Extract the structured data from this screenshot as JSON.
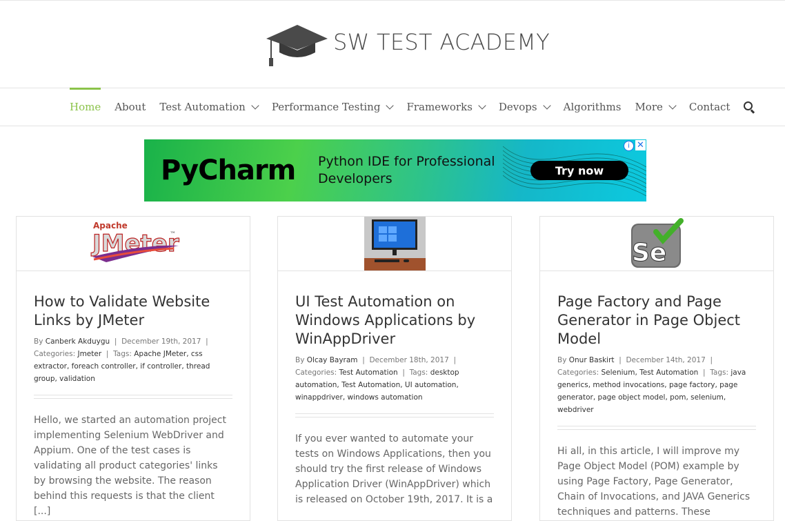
{
  "site": {
    "title": "SW TEST ACADEMY"
  },
  "nav": {
    "items": [
      {
        "label": "Home",
        "dropdown": false,
        "active": true
      },
      {
        "label": "About",
        "dropdown": false
      },
      {
        "label": "Test Automation",
        "dropdown": true
      },
      {
        "label": "Performance Testing",
        "dropdown": true
      },
      {
        "label": "Frameworks",
        "dropdown": true
      },
      {
        "label": "Devops",
        "dropdown": true
      },
      {
        "label": "Algorithms",
        "dropdown": false
      },
      {
        "label": "More",
        "dropdown": true
      },
      {
        "label": "Contact",
        "dropdown": false
      }
    ],
    "search_icon": "search-icon"
  },
  "ad": {
    "brand": "PyCharm",
    "tagline": "Python IDE for Professional Developers",
    "button": "Try now",
    "info_glyph": "i",
    "close_glyph": "✕"
  },
  "posts": [
    {
      "title": "How to Validate Website Links by JMeter",
      "by_label": "By",
      "author": "Canberk Akduygu",
      "date": "December 19th, 2017",
      "categories_label": "Categories:",
      "categories": "Jmeter",
      "tags_label": "Tags:",
      "tags": "Apache JMeter, css extractor, foreach controller, if controller, thread group, validation",
      "excerpt": "Hello, we started an automation project implementing Selenium WebDriver and Appium. One of the test cases is validating all product categories' links by browsing the website. The reason behind this requests is that the client [...]",
      "thumb": "apache-jmeter-logo",
      "thumb_text": {
        "small": "Apache",
        "big": "JMeter",
        "tm": "™"
      }
    },
    {
      "title": "UI Test Automation on Windows Applications by WinAppDriver",
      "by_label": "By",
      "author": "Olcay Bayram",
      "date": "December 18th, 2017",
      "categories_label": "Categories:",
      "categories": "Test Automation",
      "tags_label": "Tags:",
      "tags": "desktop automation, Test Automation, UI automation, winappdriver, windows automation",
      "excerpt": "If you ever wanted to automate your tests on Windows Applications, then you should try the first release of Windows Application Driver (WinAppDriver) which is released on October 19th, 2017. It is a",
      "thumb": "windows-desktop-photo"
    },
    {
      "title": "Page Factory and Page Generator in Page Object Model",
      "by_label": "By",
      "author": "Onur Baskirt",
      "date": "December 14th, 2017",
      "categories_label": "Categories:",
      "categories": "Selenium, Test Automation",
      "tags_label": "Tags:",
      "tags": "java generics, method invocations, page factory, page generator, page object model, pom, selenium, webdriver",
      "excerpt": "Hi all, in this article, I will improve my Page Object Model (POM) example by using Page Factory, Page Generator, Chain of Invocations, and JAVA Generics techniques and patterns. These",
      "thumb": "selenium-logo",
      "thumb_text": {
        "big": "Se"
      }
    }
  ],
  "colors": {
    "accent": "#8bc34a",
    "text": "#333333",
    "muted": "#777777",
    "border": "#e2e2e2"
  }
}
